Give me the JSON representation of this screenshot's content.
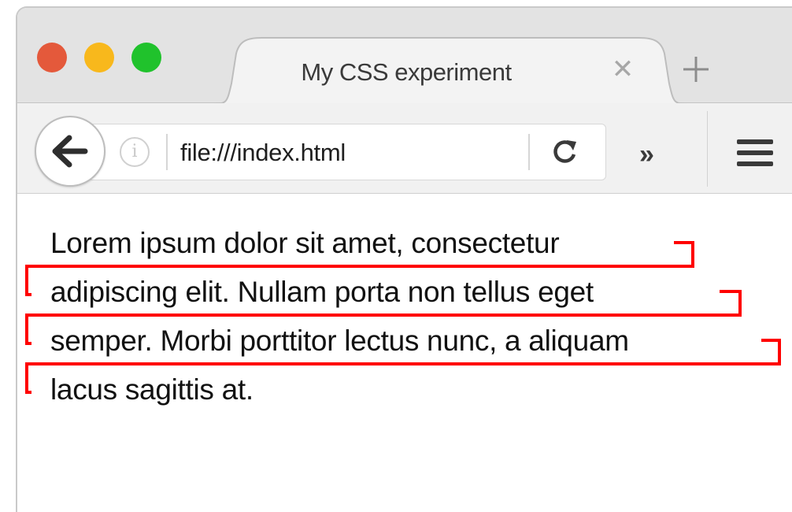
{
  "window": {
    "traffic_lights": {
      "close_color": "#e4593b",
      "minimize_color": "#f8b81c",
      "zoom_color": "#20c22c"
    }
  },
  "tab": {
    "title": "My CSS experiment",
    "close_icon": "close-icon",
    "new_tab_icon": "plus-icon"
  },
  "toolbar": {
    "back_icon": "back-arrow-icon",
    "info_icon": "info-icon",
    "info_glyph": "i",
    "url": "file:///index.html",
    "reload_icon": "reload-icon",
    "overflow_icon": "chevron-double-right-icon",
    "overflow_glyph": "»",
    "menu_icon": "hamburger-menu-icon"
  },
  "page": {
    "lines": [
      "Lorem ipsum dolor sit amet, consectetur",
      "adipiscing elit. Nullam porta non tellus eget",
      "semper. Morbi porttitor lectus nunc, a aliquam",
      "lacus sagittis at."
    ],
    "annotation_color": "#ff0000"
  }
}
